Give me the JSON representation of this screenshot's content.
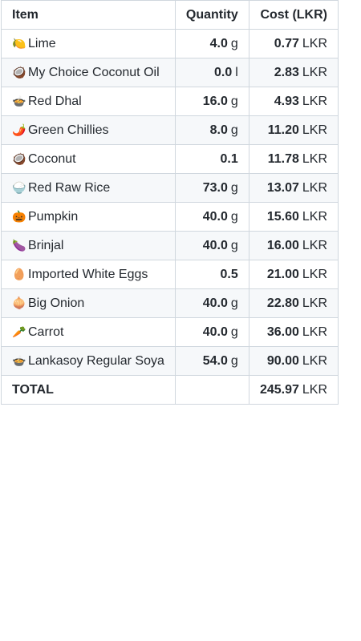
{
  "table": {
    "headers": {
      "item": "Item",
      "quantity": "Quantity",
      "cost": "Cost (LKR)"
    },
    "rows": [
      {
        "icon": "🍋",
        "icon_name": "lime-icon",
        "name": "Lime",
        "qty": "4.0",
        "qty_unit": "g",
        "cost": "0.77",
        "cost_unit": "LKR"
      },
      {
        "icon": "🥥",
        "icon_name": "coconut-icon",
        "name": "My Choice Coconut Oil",
        "qty": "0.0",
        "qty_unit": "l",
        "cost": "2.83",
        "cost_unit": "LKR"
      },
      {
        "icon": "🍲",
        "icon_name": "bowl-icon",
        "name": "Red Dhal",
        "qty": "16.0",
        "qty_unit": "g",
        "cost": "4.93",
        "cost_unit": "LKR"
      },
      {
        "icon": "🌶️",
        "icon_name": "chilli-icon",
        "name": "Green Chillies",
        "qty": "8.0",
        "qty_unit": "g",
        "cost": "11.20",
        "cost_unit": "LKR"
      },
      {
        "icon": "🥥",
        "icon_name": "coconut-icon",
        "name": "Coconut",
        "qty": "0.1",
        "qty_unit": "",
        "cost": "11.78",
        "cost_unit": "LKR"
      },
      {
        "icon": "🍚",
        "icon_name": "rice-icon",
        "name": "Red Raw Rice",
        "qty": "73.0",
        "qty_unit": "g",
        "cost": "13.07",
        "cost_unit": "LKR"
      },
      {
        "icon": "🎃",
        "icon_name": "pumpkin-icon",
        "name": "Pumpkin",
        "qty": "40.0",
        "qty_unit": "g",
        "cost": "15.60",
        "cost_unit": "LKR"
      },
      {
        "icon": "🍆",
        "icon_name": "eggplant-icon",
        "name": "Brinjal",
        "qty": "40.0",
        "qty_unit": "g",
        "cost": "16.00",
        "cost_unit": "LKR"
      },
      {
        "icon": "🥚",
        "icon_name": "egg-icon",
        "name": "Imported White Eggs",
        "qty": "0.5",
        "qty_unit": "",
        "cost": "21.00",
        "cost_unit": "LKR"
      },
      {
        "icon": "🧅",
        "icon_name": "onion-icon",
        "name": "Big Onion",
        "qty": "40.0",
        "qty_unit": "g",
        "cost": "22.80",
        "cost_unit": "LKR"
      },
      {
        "icon": "🥕",
        "icon_name": "carrot-icon",
        "name": "Carrot",
        "qty": "40.0",
        "qty_unit": "g",
        "cost": "36.00",
        "cost_unit": "LKR"
      },
      {
        "icon": "🍲",
        "icon_name": "bowl-icon",
        "name": "Lankasoy Regular Soya",
        "qty": "54.0",
        "qty_unit": "g",
        "cost": "90.00",
        "cost_unit": "LKR"
      }
    ],
    "total": {
      "label": "TOTAL",
      "cost": "245.97",
      "cost_unit": "LKR"
    }
  }
}
